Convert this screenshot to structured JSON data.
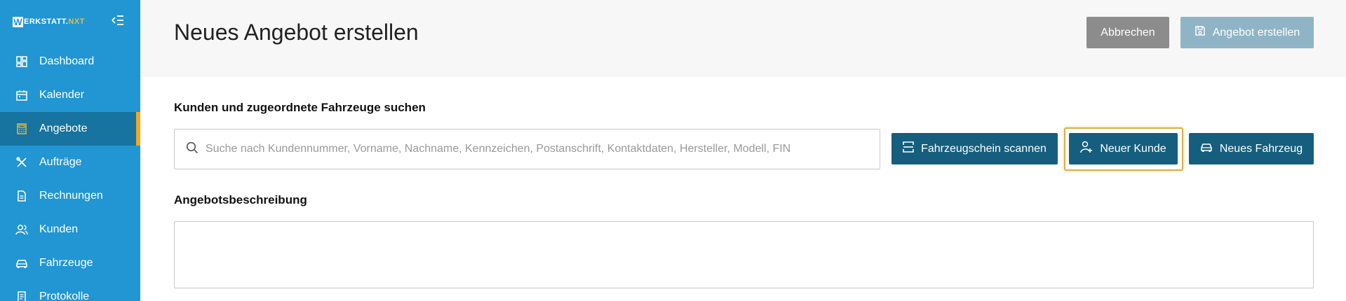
{
  "brand": {
    "initial": "W",
    "name": "ERKSTATT.",
    "suffix": "NXT"
  },
  "sidebar": {
    "items": [
      {
        "label": "Dashboard",
        "icon": "dashboard-icon",
        "active": false
      },
      {
        "label": "Kalender",
        "icon": "calendar-icon",
        "active": false
      },
      {
        "label": "Angebote",
        "icon": "calculator-icon",
        "active": true
      },
      {
        "label": "Aufträge",
        "icon": "tools-icon",
        "active": false
      },
      {
        "label": "Rechnungen",
        "icon": "document-icon",
        "active": false
      },
      {
        "label": "Kunden",
        "icon": "users-icon",
        "active": false
      },
      {
        "label": "Fahrzeuge",
        "icon": "car-icon",
        "active": false
      },
      {
        "label": "Protokolle",
        "icon": "protocol-icon",
        "active": false
      }
    ]
  },
  "header": {
    "title": "Neues Angebot erstellen",
    "cancel_label": "Abbrechen",
    "create_label": "Angebot erstellen"
  },
  "customer_search": {
    "heading": "Kunden und zugeordnete Fahrzeuge suchen",
    "placeholder": "Suche nach Kundennummer, Vorname, Nachname, Kennzeichen, Postanschrift, Kontaktdaten, Hersteller, Modell, FIN",
    "value": "",
    "scan_label": "Fahrzeugschein scannen",
    "new_customer_label": "Neuer Kunde",
    "new_vehicle_label": "Neues Fahrzeug"
  },
  "description": {
    "heading": "Angebotsbeschreibung",
    "value": ""
  },
  "colors": {
    "sidebar": "#2196d3",
    "sidebar_active": "#17739f",
    "active_indicator": "#f5a623",
    "brand_accent": "#f5b82e",
    "primary_dark": "#155e7d",
    "cancel": "#8c8c8c",
    "create_disabled": "#8fb4c6",
    "highlight": "#d8b14a"
  }
}
